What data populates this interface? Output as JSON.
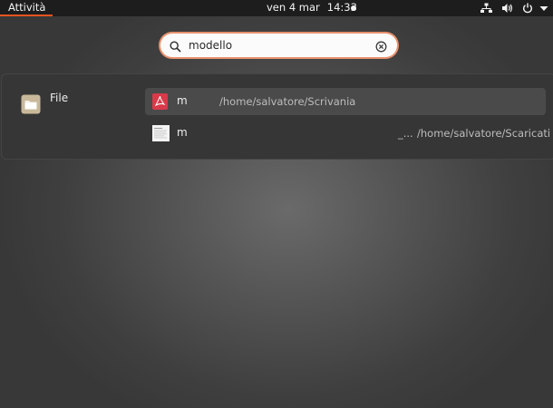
{
  "topbar": {
    "activities_label": "Attività",
    "date": "ven 4 mar",
    "time": "14:33",
    "icons": [
      "network-icon",
      "volume-icon",
      "power-icon",
      "menu-arrow-icon"
    ]
  },
  "search": {
    "value": "modello",
    "icon": "search-icon",
    "clear_icon": "clear-icon"
  },
  "results": {
    "provider": {
      "label": "File",
      "icon": "folder-icon"
    },
    "items": [
      {
        "name": "m",
        "path": "/home/salvatore/Scrivania",
        "extra": "",
        "icon": "pdf-icon",
        "selected": true
      },
      {
        "name": "m",
        "path": "/home/salvatore/Scaricati",
        "extra": "_...",
        "icon": "document-thumbnail-icon",
        "selected": false
      }
    ]
  },
  "colors": {
    "accent": "#e95420",
    "topbar": "#1d1d1d",
    "panel": "#363636",
    "pdf_red": "#d83a4a"
  }
}
